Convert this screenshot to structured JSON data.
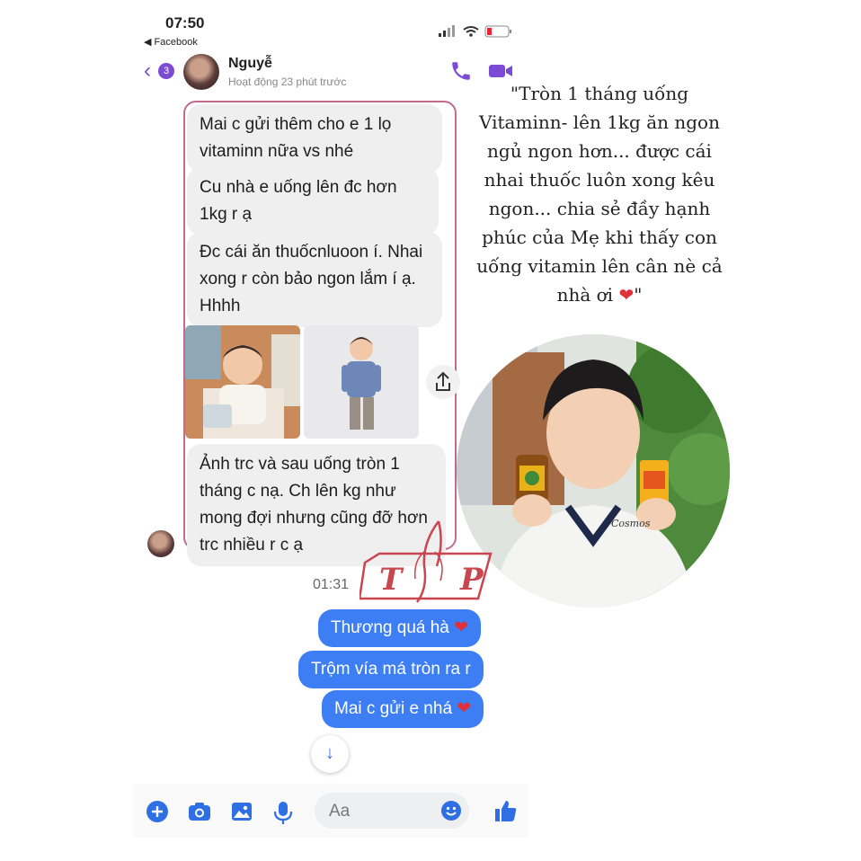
{
  "status": {
    "time": "07:50",
    "back_app": "◀ Facebook"
  },
  "header": {
    "badge": "3",
    "name": "Nguyễ",
    "active": "Hoạt động 23 phút trước"
  },
  "incoming": [
    {
      "text": "Mai c gửi thêm cho e 1 lọ vitaminn nữa vs nhé"
    },
    {
      "text": "Cu nhà e uống lên đc hơn 1kg r ạ"
    },
    {
      "text": "Đc cái ăn thuốcnluoon í. Nhai xong r còn bảo ngon lắm í ạ. Hhhh"
    },
    {
      "text": "Ảnh trc và sau uống tròn 1 tháng c nạ. Ch lên kg như mong đợi nhưng cũng đỡ hơn trc nhiều r c ạ"
    }
  ],
  "timestamp": "01:31",
  "outgoing": [
    {
      "text": "Thương quá hà",
      "emoji": "❤"
    },
    {
      "text": "Trộm vía má tròn ra r",
      "emoji": ""
    },
    {
      "text": "Mai c gửi e nhá",
      "emoji": "❤"
    }
  ],
  "composer": {
    "placeholder": "Aa"
  },
  "quote": {
    "text": "\"Tròn 1 tháng uống Vitaminn- lên 1kg ăn ngon ngủ ngon hơn... được cái nhai thuốc luôn xong kêu ngon... chia sẻ đầy hạnh phúc của Mẹ khi thấy con uống vitamin lên cân nè cả nhà ơi",
    "heart": "❤",
    "end": "\""
  },
  "photo_shirt_text": "Cosmos",
  "watermark": {
    "left": "T",
    "right": "P"
  },
  "colors": {
    "accent": "#7b4bd6",
    "outgoing_bubble": "#3d7ef5",
    "highlight": "#c56a8d",
    "heart": "#e0303a"
  }
}
